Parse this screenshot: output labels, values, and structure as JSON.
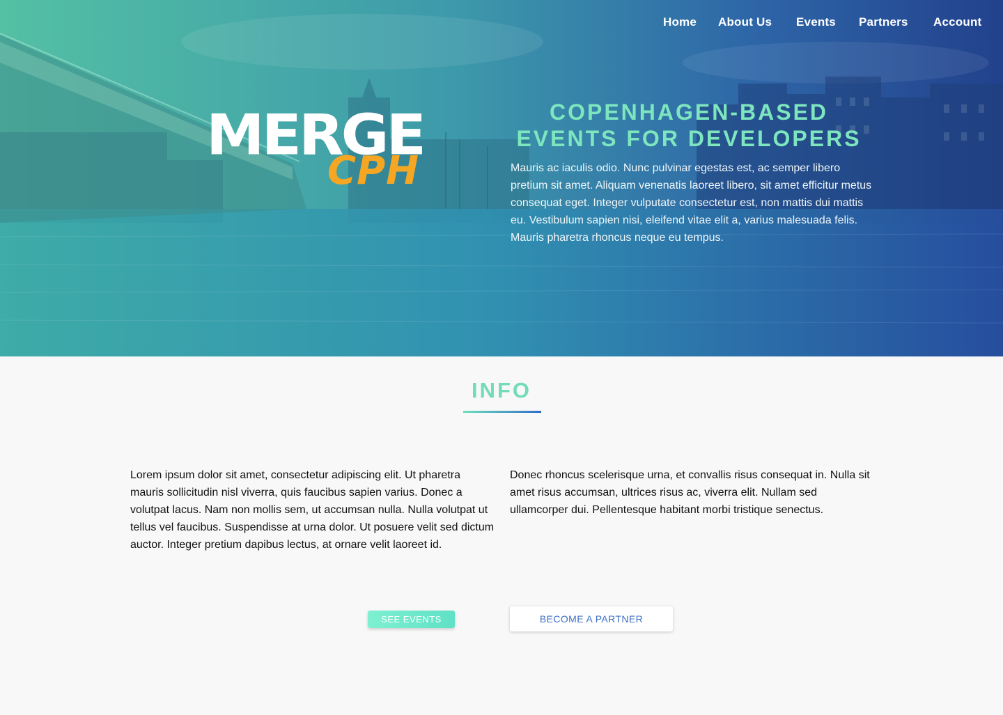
{
  "nav": {
    "items": [
      "Home",
      "About Us",
      "Events",
      "Partners",
      "Account"
    ]
  },
  "logo": {
    "primary": "MERGE",
    "secondary": "CPH"
  },
  "hero": {
    "tagline_line1": "COPENHAGEN-BASED",
    "tagline_line2": "EVENTS FOR DEVELOPERS",
    "text": "Mauris ac iaculis odio. Nunc pulvinar egestas est, ac semper libero pretium sit amet. Aliquam venenatis laoreet libero, sit amet efficitur metus consequat eget. Integer vulputate consectetur est, non mattis dui mattis eu. Vestibulum sapien nisi, eleifend vitae elit a, varius malesuada felis. Mauris pharetra rhoncus neque eu tempus."
  },
  "info": {
    "title": "INFO",
    "left_text": "Lorem ipsum dolor sit amet, consectetur adipiscing elit. Ut pharetra mauris sollicitudin nisl viverra, quis faucibus sapien varius. Donec a volutpat lacus. Nam non mollis sem, ut accumsan nulla. Nulla volutpat ut tellus vel faucibus. Suspendisse at urna dolor. Ut posuere velit sed dictum auctor. Integer pretium dapibus lectus, at ornare velit laoreet id.",
    "right_text": "Donec rhoncus scelerisque urna, et convallis risus consequat in. Nulla sit amet risus accumsan, ultrices risus ac, viverra elit. Nullam sed ullamcorper dui. Pellentesque habitant morbi tristique senectus."
  },
  "buttons": {
    "see_events": "SEE EVENTS",
    "become_partner": "BECOME A PARTNER"
  },
  "colors": {
    "accent_green": "#72dbb8",
    "logo_orange": "#f5a623",
    "partner_blue": "#3d6fc7"
  }
}
